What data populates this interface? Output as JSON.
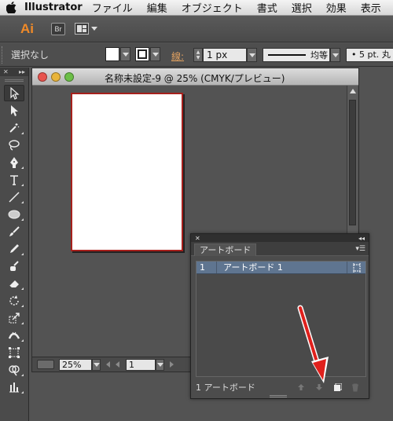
{
  "menubar": {
    "apple_icon": "apple-icon",
    "app": "Illustrator",
    "items": [
      "ファイル",
      "編集",
      "オブジェクト",
      "書式",
      "選択",
      "効果",
      "表示"
    ]
  },
  "appbar": {
    "logo": "Ai",
    "bridge": "Br"
  },
  "control": {
    "selection": "選択なし",
    "stroke_label": "線:",
    "stroke_weight": "1 px",
    "profile": "均等",
    "brush": "5 pt. 丸"
  },
  "document": {
    "title": "名称未設定-9 @ 25% (CMYK/プレビュー)",
    "zoom": "25%",
    "page": "1"
  },
  "panel": {
    "tab": "アートボード",
    "rows": [
      {
        "num": "1",
        "name": "アートボード 1"
      }
    ],
    "footer": "1 アートボード"
  },
  "colors": {
    "artboard_border": "#a6201c",
    "selection_row": "#5f7590",
    "logo": "#f08a28",
    "annotation_arrow": "#e0201c"
  }
}
